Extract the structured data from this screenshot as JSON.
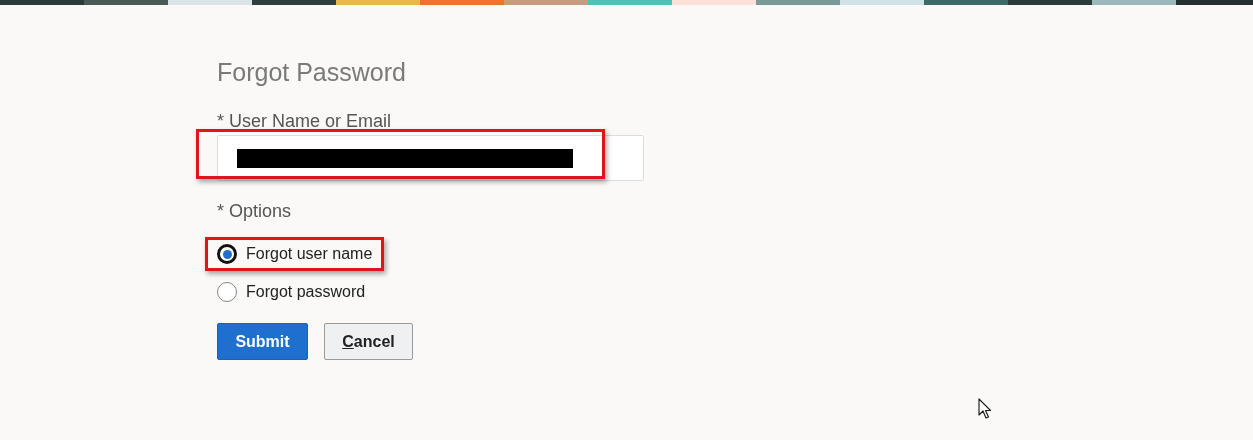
{
  "title": "Forgot Password",
  "username_field": {
    "label": "* User Name or Email",
    "value_redacted": true,
    "highlighted": true
  },
  "options": {
    "label": "* Options",
    "items": [
      {
        "label": "Forgot user name",
        "selected": true,
        "highlighted": true
      },
      {
        "label": "Forgot password",
        "selected": false,
        "highlighted": false
      }
    ]
  },
  "buttons": [
    {
      "kind": "primary",
      "label": "Submit",
      "access_key_underlined": false
    },
    {
      "kind": "secondary",
      "label": "Cancel",
      "access_key_underlined": true
    }
  ],
  "mouse_cursor": true
}
